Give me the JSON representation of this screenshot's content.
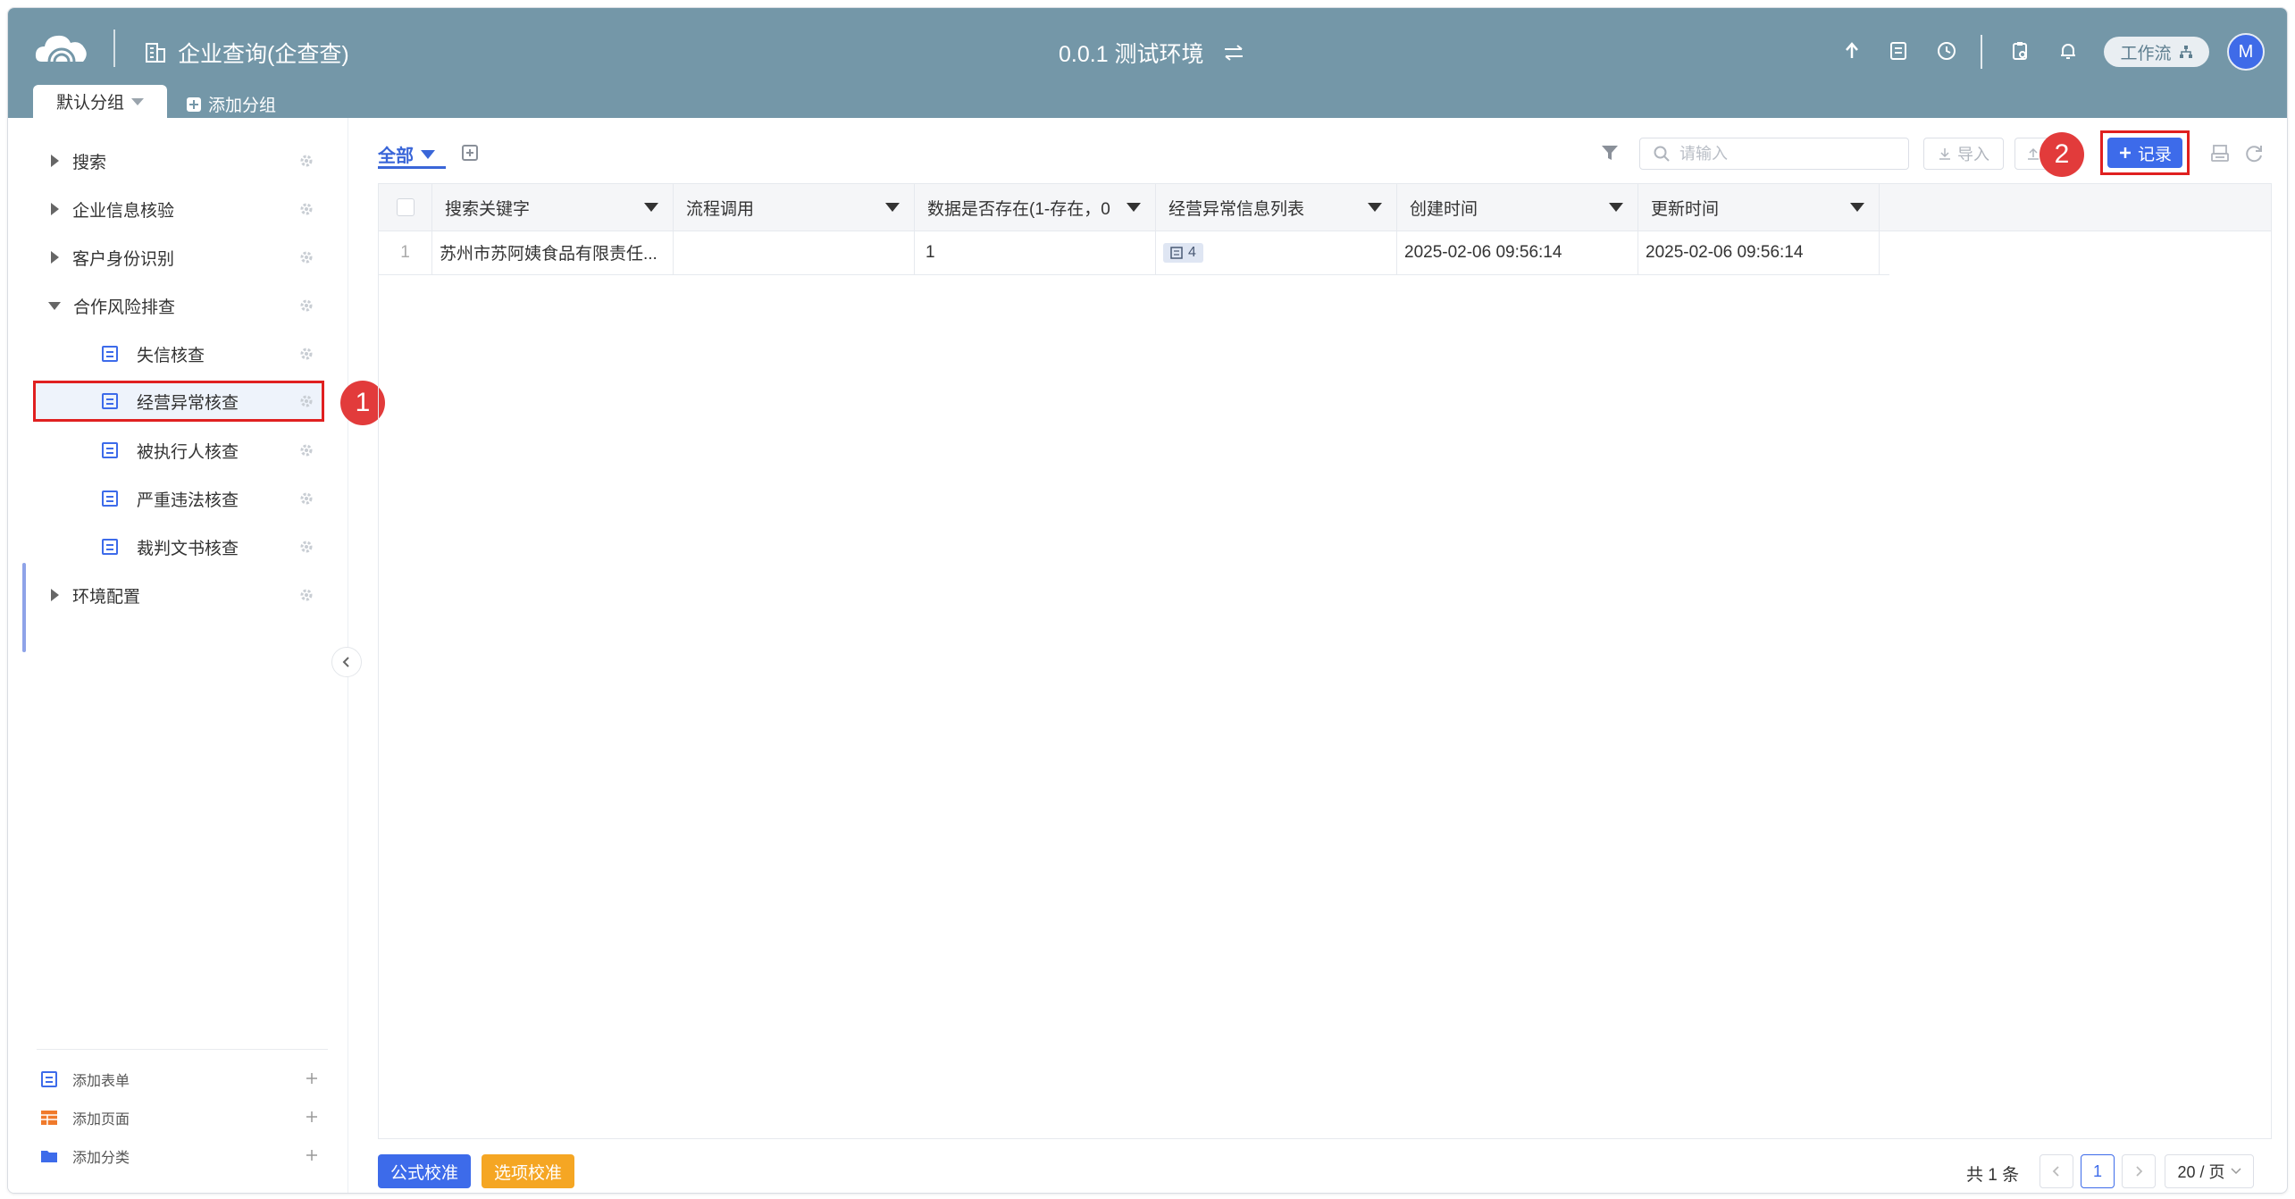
{
  "header": {
    "app_title": "企业查询(企查查)",
    "env_title": "0.0.1 测试环境",
    "workflow_label": "工作流",
    "avatar_initial": "M",
    "group_tab_label": "默认分组",
    "add_group_label": "添加分组",
    "bg_color": "#7497a8"
  },
  "sidebar": {
    "items": [
      {
        "label": "搜索",
        "type": "group",
        "expanded": false
      },
      {
        "label": "企业信息核验",
        "type": "group",
        "expanded": false
      },
      {
        "label": "客户身份识别",
        "type": "group",
        "expanded": false
      },
      {
        "label": "合作风险排查",
        "type": "group",
        "expanded": true
      },
      {
        "label": "失信核查",
        "type": "form"
      },
      {
        "label": "经营异常核查",
        "type": "form",
        "selected": true
      },
      {
        "label": "被执行人核查",
        "type": "form"
      },
      {
        "label": "严重违法核查",
        "type": "form"
      },
      {
        "label": "裁判文书核查",
        "type": "form"
      },
      {
        "label": "环境配置",
        "type": "group",
        "expanded": false
      }
    ],
    "bottom": {
      "add_form": "添加表单",
      "add_page": "添加页面",
      "add_category": "添加分类"
    }
  },
  "annotations": {
    "badge1": "1",
    "badge2": "2"
  },
  "toolbar": {
    "view_label": "全部",
    "search_placeholder": "请输入",
    "import_label": "导入",
    "record_label": "记录",
    "accent": "#3d6bea"
  },
  "table": {
    "columns": [
      "搜索关键字",
      "流程调用",
      "数据是否存在(1-存在，0",
      "经营异常信息列表",
      "创建时间",
      "更新时间"
    ],
    "rows": [
      {
        "index": "1",
        "keyword": "苏州市苏阿姨食品有限责任...",
        "process": "",
        "exists": "1",
        "list_count": "4",
        "created": "2025-02-06 09:56:14",
        "updated": "2025-02-06 09:56:14"
      }
    ]
  },
  "footer": {
    "formula_btn": "公式校准",
    "option_btn": "选项校准",
    "total": "共 1 条",
    "current_page": "1",
    "page_size": "20 / 页"
  }
}
